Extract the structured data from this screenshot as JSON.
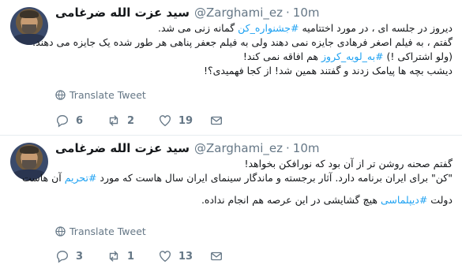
{
  "tweets": [
    {
      "name": "سید عزت الله ضرغامی",
      "handle": "@Zarghami_ez",
      "dot": "·",
      "time": "10m",
      "lines": [
        {
          "text": "دیروز در جلسه ای ، در مورد اختتامیه ",
          "tag": "#جشنواره_کن",
          "after": " گمانه زنی می شد."
        },
        {
          "text": "گفتم ، به فیلم اصغر فرهادی جایزه نمی دهند ولی به فیلم جعفر پناهی هر طور شده یک جایزه می دهند.",
          "tag": "",
          "after": ""
        },
        {
          "text": "(ولو اشتراکی !) ",
          "tag": "#به_لویه_کروز",
          "after": " هم افاقه نمی کند!"
        },
        {
          "text": "دیشب بچه ها پیامک زدند و گفتند همین شد! از کجا فهمیدی؟!",
          "tag": "",
          "after": ""
        }
      ],
      "translate": "Translate Tweet",
      "replies": "6",
      "retweets": "2",
      "likes": "19"
    },
    {
      "name": "سید عزت الله ضرغامی",
      "handle": "@Zarghami_ez",
      "dot": "·",
      "time": "10m",
      "lines": [
        {
          "text": "گفتم صحنه روشن تر از آن بود که نورافکن بخواهد!",
          "tag": "",
          "after": ""
        },
        {
          "text": "\"کن\" برای ایران برنامه دارد. آثار برجسته و ماندگار سینمای ایران سال هاست که مورد ",
          "tag": "#تحریم",
          "after": " آن هاست"
        },
        {
          "text": "دولت ",
          "tag": "#دیپلماسی",
          "after": " هیچ گشایشی در این عرصه هم انجام نداده."
        }
      ],
      "translate": "Translate Tweet",
      "replies": "3",
      "retweets": "1",
      "likes": "13"
    }
  ]
}
